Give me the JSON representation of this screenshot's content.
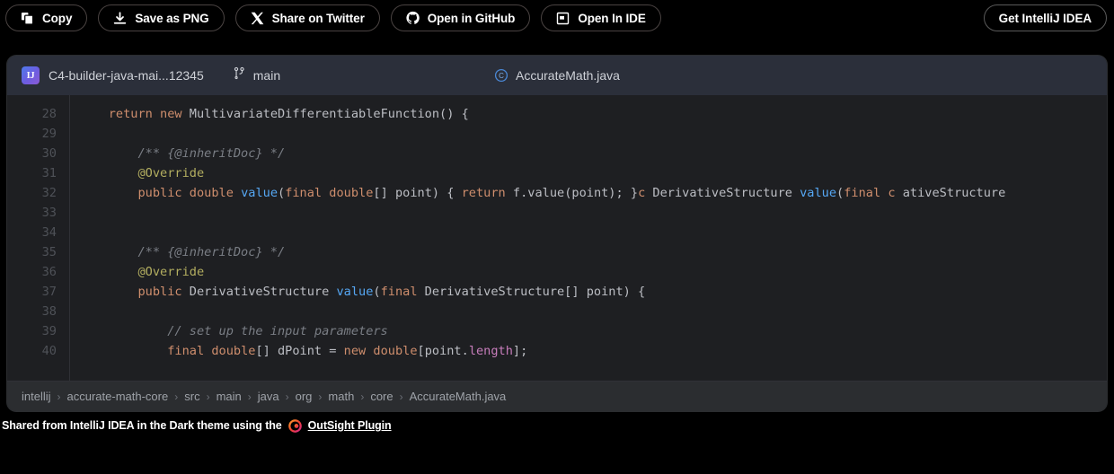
{
  "toolbar": {
    "buttons": [
      {
        "label": "Copy",
        "icon": "copy-icon"
      },
      {
        "label": "Save as PNG",
        "icon": "download-icon"
      },
      {
        "label": "Share on Twitter",
        "icon": "x-twitter-icon"
      },
      {
        "label": "Open in GitHub",
        "icon": "github-icon"
      },
      {
        "label": "Open In IDE",
        "icon": "ide-monitor-icon"
      }
    ],
    "cta": {
      "label": "Get IntelliJ IDEA"
    }
  },
  "ide_header": {
    "logo_text": "IJ",
    "project": "C4-builder-java-mai...12345",
    "branch": "main",
    "branch_icon": "git-branch-icon",
    "file": "AccurateMath.java",
    "file_icon": "java-class-icon"
  },
  "editor": {
    "line_numbers": [
      "28",
      "29",
      "30",
      "31",
      "32",
      "33",
      "34",
      "35",
      "36",
      "37",
      "38",
      "39",
      "40"
    ],
    "lines": [
      [
        {
          "t": "    ",
          "c": "df"
        },
        {
          "t": "return",
          "c": "k"
        },
        {
          "t": " ",
          "c": "df"
        },
        {
          "t": "new",
          "c": "k"
        },
        {
          "t": " MultivariateDifferentiableFunction() {",
          "c": "df"
        }
      ],
      [],
      [
        {
          "t": "        ",
          "c": "df"
        },
        {
          "t": "/** {@inheritDoc} */",
          "c": "cm"
        }
      ],
      [
        {
          "t": "        ",
          "c": "df"
        },
        {
          "t": "@Override",
          "c": "an"
        }
      ],
      [
        {
          "t": "        ",
          "c": "df"
        },
        {
          "t": "public",
          "c": "k"
        },
        {
          "t": " ",
          "c": "df"
        },
        {
          "t": "double",
          "c": "k"
        },
        {
          "t": " ",
          "c": "df"
        },
        {
          "t": "value",
          "c": "mt"
        },
        {
          "t": "(",
          "c": "df"
        },
        {
          "t": "final",
          "c": "k"
        },
        {
          "t": " ",
          "c": "df"
        },
        {
          "t": "double",
          "c": "k"
        },
        {
          "t": "[] point) { ",
          "c": "df"
        },
        {
          "t": "return",
          "c": "k"
        },
        {
          "t": " f.value(point); }",
          "c": "df"
        },
        {
          "t": "c",
          "c": "k"
        },
        {
          "t": " DerivativeStructure ",
          "c": "df"
        },
        {
          "t": "value",
          "c": "mt"
        },
        {
          "t": "(",
          "c": "df"
        },
        {
          "t": "final",
          "c": "k"
        },
        {
          "t": " ",
          "c": "df"
        },
        {
          "t": "c",
          "c": "k"
        },
        {
          "t": " ativeStructure",
          "c": "df"
        }
      ],
      [],
      [],
      [
        {
          "t": "        ",
          "c": "df"
        },
        {
          "t": "/** {@inheritDoc} */",
          "c": "cm"
        }
      ],
      [
        {
          "t": "        ",
          "c": "df"
        },
        {
          "t": "@Override",
          "c": "an"
        }
      ],
      [
        {
          "t": "        ",
          "c": "df"
        },
        {
          "t": "public",
          "c": "k"
        },
        {
          "t": " DerivativeStructure ",
          "c": "df"
        },
        {
          "t": "value",
          "c": "mt"
        },
        {
          "t": "(",
          "c": "df"
        },
        {
          "t": "final",
          "c": "k"
        },
        {
          "t": " DerivativeStructure[] point) {",
          "c": "df"
        }
      ],
      [],
      [
        {
          "t": "            ",
          "c": "df"
        },
        {
          "t": "// set up the input parameters",
          "c": "cm"
        }
      ],
      [
        {
          "t": "            ",
          "c": "df"
        },
        {
          "t": "final",
          "c": "k"
        },
        {
          "t": " ",
          "c": "df"
        },
        {
          "t": "double",
          "c": "k"
        },
        {
          "t": "[] dPoint = ",
          "c": "df"
        },
        {
          "t": "new",
          "c": "k"
        },
        {
          "t": " ",
          "c": "df"
        },
        {
          "t": "double",
          "c": "k"
        },
        {
          "t": "[point.",
          "c": "df"
        },
        {
          "t": "length",
          "c": "fl"
        },
        {
          "t": "];",
          "c": "df"
        }
      ]
    ]
  },
  "breadcrumb": {
    "items": [
      "intellij",
      "accurate-math-core",
      "src",
      "main",
      "java",
      "org",
      "math",
      "core",
      "AccurateMath.java"
    ],
    "separator": "›"
  },
  "footer": {
    "text": "Shared from IntelliJ IDEA in the Dark theme using the",
    "link": "OutSight Plugin",
    "icon": "outsight-eye-icon"
  },
  "colors": {
    "page_background": "#000000",
    "editor_background": "#1e1f22",
    "header_background": "#2b2f3a",
    "breadcrumb_background": "#2b2d30",
    "keyword": "#cf8e6d",
    "method": "#56a8f5",
    "comment": "#7a7e85",
    "annotation": "#b3ae60",
    "field": "#c77dbb",
    "default_text": "#bcbec4",
    "line_number": "#4e5157"
  }
}
